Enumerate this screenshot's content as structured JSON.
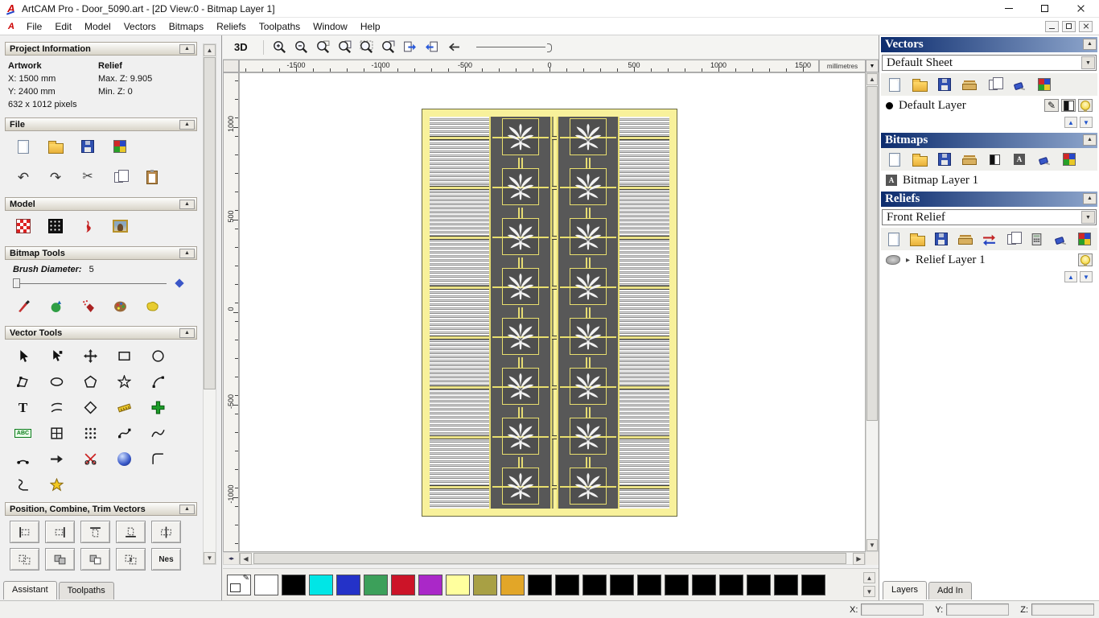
{
  "window": {
    "title": "ArtCAM Pro - Door_5090.art - [2D View:0 - Bitmap Layer 1]"
  },
  "menu": {
    "items": [
      "File",
      "Edit",
      "Model",
      "Vectors",
      "Bitmaps",
      "Reliefs",
      "Toolpaths",
      "Window",
      "Help"
    ]
  },
  "assistant": {
    "project_information": {
      "title": "Project Information",
      "artwork": {
        "label": "Artwork",
        "x": "X: 1500 mm",
        "y": "Y: 2400 mm",
        "pixels": "632 x 1012 pixels"
      },
      "relief": {
        "label": "Relief",
        "max_z": "Max. Z: 9.905",
        "min_z": "Min. Z: 0"
      }
    },
    "file_section": {
      "title": "File",
      "icons_row1": [
        "new-document",
        "open-folder",
        "save",
        "import-model"
      ],
      "icons_row2": [
        "undo",
        "redo",
        "cut",
        "copy",
        "paste"
      ]
    },
    "model_section": {
      "title": "Model",
      "icons": [
        "texture-relief",
        "invert-relief",
        "sculpt",
        "load-picture"
      ]
    },
    "bitmap_tools": {
      "title": "Bitmap Tools",
      "brush_label": "Brush Diameter:",
      "brush_value": "5",
      "icons": [
        "paint-brush",
        "flood-fill",
        "spray",
        "colour-palette",
        "sponge"
      ]
    },
    "vector_tools": {
      "title": "Vector Tools",
      "tools": [
        "select-vectors",
        "node-editing",
        "transform-vectors",
        "create-rectangle",
        "create-circle",
        "create-polyline",
        "create-ellipse",
        "create-polygon",
        "create-star",
        "create-arc",
        "create-text",
        "shear-vectors",
        "create-diamond",
        "measure-tool",
        "paste-in-position",
        "text-on-curve",
        "paste-along-curve",
        "block-copy",
        "fit-curve",
        "smooth-curve",
        "join-vectors",
        "arrow-tool",
        "trim-vectors",
        "extrude-tool",
        "fillet-tool",
        "section-tool",
        "wrap-star"
      ]
    },
    "position_section": {
      "title": "Position, Combine, Trim Vectors",
      "row1": [
        "align-left",
        "align-right",
        "align-top",
        "align-bottom",
        "align-center"
      ],
      "row2": [
        "group-vectors",
        "combine-union",
        "combine-subtract",
        "combine-intersect",
        "nesting"
      ],
      "nesting_label": "Nes"
    },
    "tabs": [
      {
        "label": "Assistant"
      },
      {
        "label": "Toolpaths"
      }
    ]
  },
  "view": {
    "toolbar": {
      "mode_3d": "3D",
      "icons": [
        "zoom-in",
        "zoom-out",
        "zoom-object",
        "zoom-page",
        "zoom-fit",
        "zoom-selected",
        "step-next",
        "step-prev",
        "previous-view"
      ]
    },
    "hruler": {
      "ticks": [
        "-1500",
        "-1000",
        "-500",
        "0",
        "500",
        "1000",
        "1500"
      ],
      "units": "millimetres"
    },
    "vruler": {
      "ticks": [
        "1000",
        "500",
        "0",
        "-500",
        "-1000"
      ]
    },
    "door": {
      "rows": 8,
      "cols": 2
    }
  },
  "palette": {
    "colors": [
      "#ffffff",
      "#000000",
      "#00e6e6",
      "#2432c8",
      "#3ca05a",
      "#cc1428",
      "#aa28c8",
      "#ffff9e",
      "#a8a044",
      "#e2a628",
      "#000000",
      "#000000",
      "#000000",
      "#000000",
      "#000000",
      "#000000",
      "#000000",
      "#000000",
      "#000000",
      "#000000",
      "#000000"
    ]
  },
  "layers_panel": {
    "vectors": {
      "title": "Vectors",
      "sheet": "Default Sheet",
      "toolbar": [
        "new-document",
        "open-folder",
        "save",
        "stack",
        "copy",
        "delete-layer",
        "merge-layers"
      ],
      "layer": {
        "name": "Default Layer",
        "buttons": [
          "edit-pencil",
          "contrast",
          "visibility-bulb"
        ]
      }
    },
    "bitmaps": {
      "title": "Bitmaps",
      "toolbar": [
        "new-document",
        "open-folder",
        "save",
        "stack",
        "contrast",
        "stamp",
        "delete-layer",
        "merge-layers"
      ],
      "layer": {
        "name": "Bitmap Layer 1"
      }
    },
    "reliefs": {
      "title": "Reliefs",
      "relief": "Front Relief",
      "toolbar": [
        "new-document",
        "open-folder",
        "save",
        "stack",
        "swap-arrows",
        "copy",
        "calculator",
        "delete-layer",
        "merge-layers"
      ],
      "layer": {
        "name": "Relief Layer 1",
        "buttons": [
          "visibility-bulb"
        ]
      }
    },
    "tabs": [
      {
        "label": "Layers"
      },
      {
        "label": "Add In"
      }
    ]
  },
  "statusbar": {
    "x_label": "X:",
    "x_value": "",
    "y_label": "Y:",
    "y_value": "",
    "z_label": "Z:",
    "z_value": ""
  }
}
